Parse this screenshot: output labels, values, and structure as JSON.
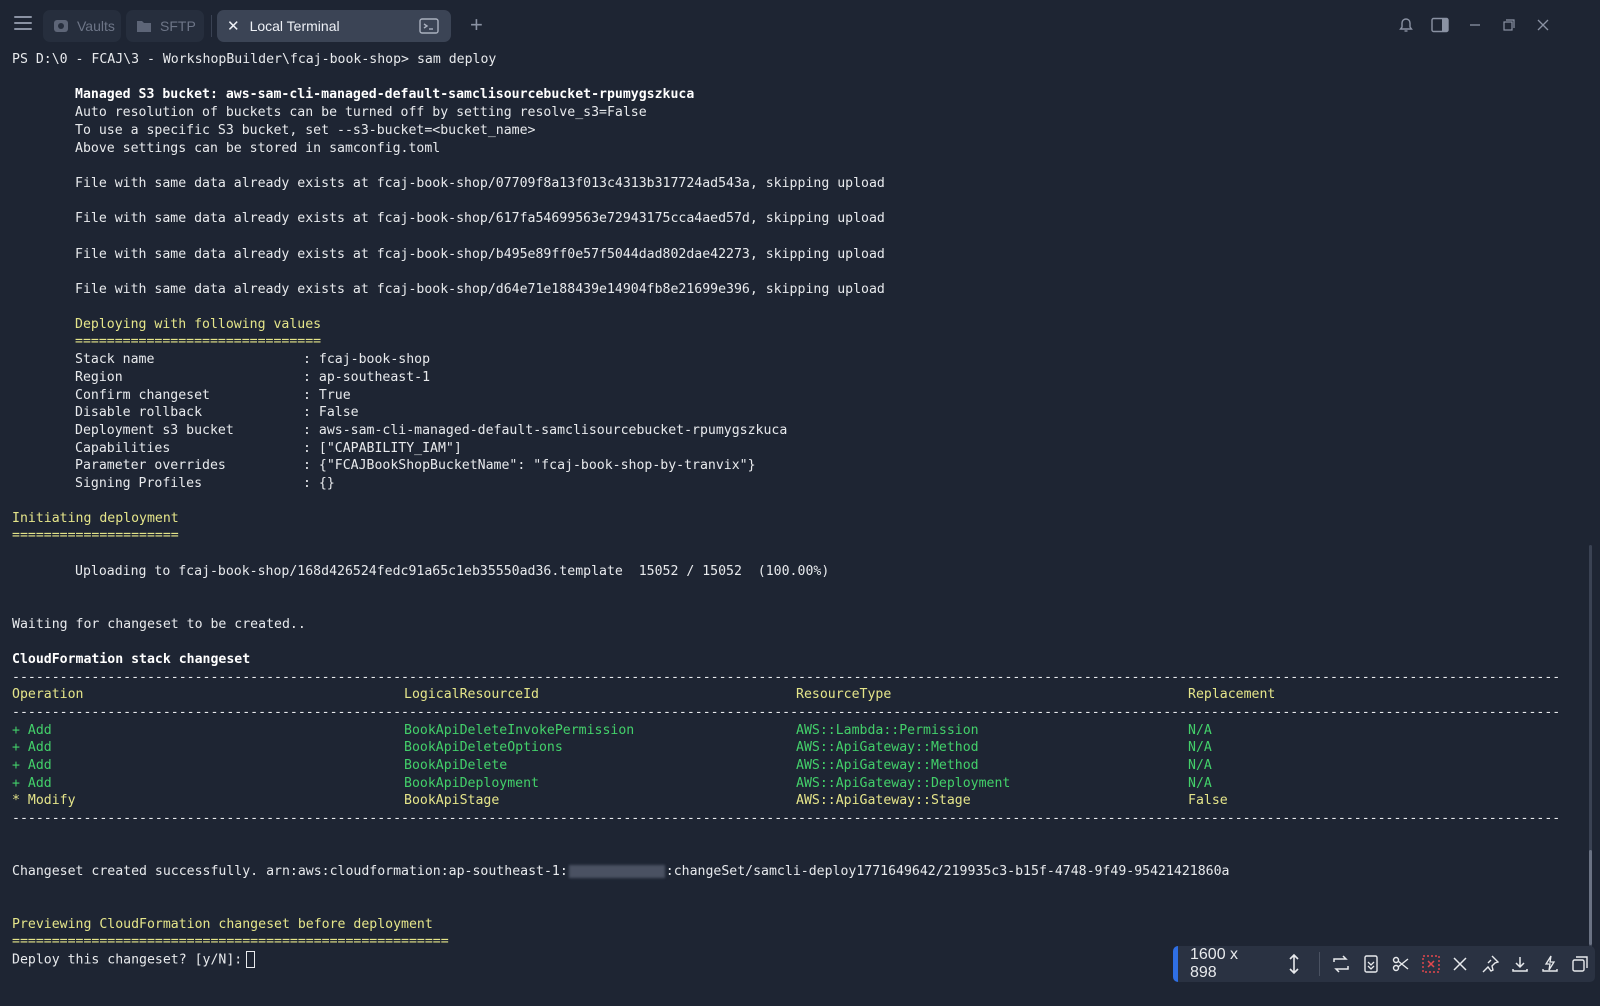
{
  "tabs": [
    {
      "label": "Vaults"
    },
    {
      "label": "SFTP"
    },
    {
      "label": "Local Terminal"
    }
  ],
  "terminal": {
    "prompt": "PS D:\\0 - FCAJ\\3 - WorkshopBuilder\\fcaj-book-shop>",
    "command": "sam deploy",
    "managed_bucket": "Managed S3 bucket: aws-sam-cli-managed-default-samclisourcebucket-rpumygszkuca",
    "auto_res": "Auto resolution of buckets can be turned off by setting resolve_s3=False",
    "specific_bucket": "To use a specific S3 bucket, set --s3-bucket=<bucket_name>",
    "stored": "Above settings can be stored in samconfig.toml",
    "files": [
      "File with same data already exists at fcaj-book-shop/07709f8a13f013c4313b317724ad543a, skipping upload",
      "File with same data already exists at fcaj-book-shop/617fa54699563e72943175cca4aed57d, skipping upload",
      "File with same data already exists at fcaj-book-shop/b495e89ff0e57f5044dad802dae42273, skipping upload",
      "File with same data already exists at fcaj-book-shop/d64e71e188439e14904fb8e21699e396, skipping upload"
    ],
    "deploying_header": "Deploying with following values",
    "deploying_rule": "===============================",
    "values": [
      {
        "key": "Stack name",
        "value": ": fcaj-book-shop"
      },
      {
        "key": "Region",
        "value": ": ap-southeast-1"
      },
      {
        "key": "Confirm changeset",
        "value": ": True"
      },
      {
        "key": "Disable rollback",
        "value": ": False"
      },
      {
        "key": "Deployment s3 bucket",
        "value": ": aws-sam-cli-managed-default-samclisourcebucket-rpumygszkuca"
      },
      {
        "key": "Capabilities",
        "value": ": [\"CAPABILITY_IAM\"]"
      },
      {
        "key": "Parameter overrides",
        "value": ": {\"FCAJBookShopBucketName\": \"fcaj-book-shop-by-tranvix\"}"
      },
      {
        "key": "Signing Profiles",
        "value": ": {}"
      }
    ],
    "initiating": "Initiating deployment",
    "initiating_rule": "=====================",
    "uploading": "Uploading to fcaj-book-shop/168d426524fedc91a65c1eb35550ad36.template  15052 / 15052  (100.00%)",
    "waiting": "Waiting for changeset to be created..",
    "cf_title": "CloudFormation stack changeset",
    "dash_rule": "---------------------------------------------------------------------------------------------------------------------------------------------------------------------------------------------------",
    "columns": [
      "Operation",
      "LogicalResourceId",
      "ResourceType",
      "Replacement"
    ],
    "rows": [
      [
        "+ Add",
        "BookApiDeleteInvokePermission",
        "AWS::Lambda::Permission",
        "N/A"
      ],
      [
        "+ Add",
        "BookApiDeleteOptions",
        "AWS::ApiGateway::Method",
        "N/A"
      ],
      [
        "+ Add",
        "BookApiDelete",
        "AWS::ApiGateway::Method",
        "N/A"
      ],
      [
        "+ Add",
        "BookApiDeployment",
        "AWS::ApiGateway::Deployment",
        "N/A"
      ],
      [
        "* Modify",
        "BookApiStage",
        "AWS::ApiGateway::Stage",
        "False"
      ]
    ],
    "changeset_prefix": "Changeset created successfully. arn:aws:cloudformation:ap-southeast-1:",
    "changeset_suffix": ":changeSet/samcli-deploy1771649642/219935c3-b15f-4748-9f49-95421421860a",
    "previewing": "Previewing CloudFormation changeset before deployment",
    "previewing_rule": "=======================================================",
    "deploy_prompt": "Deploy this changeset? [y/N]:"
  },
  "toolbar": {
    "dimensions": "1600 x 898"
  },
  "colors": {
    "background": "#1e2533",
    "yellow": "#e5e58a",
    "green": "#43d06a",
    "accent": "#2f6fe4"
  }
}
